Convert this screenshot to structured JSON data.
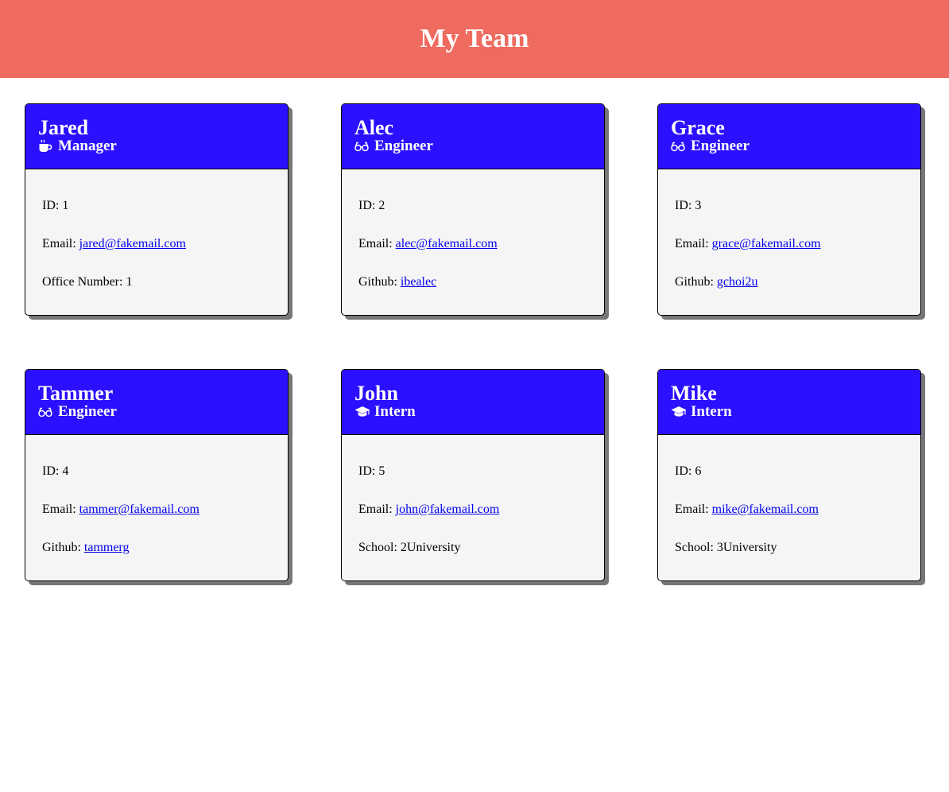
{
  "header": {
    "title": "My Team",
    "background": "#ef6a5f"
  },
  "theme": {
    "card_header_bg": "#2b10ff",
    "card_body_bg": "#f5f5f5",
    "link_color": "#0000ee"
  },
  "cards": [
    {
      "name": "Jared",
      "role": "Manager",
      "icon": "coffee-icon",
      "id_label": "ID: ",
      "id": "1",
      "email_label": "Email: ",
      "email": "jared@fakemail.com",
      "extra_label": "Office Number: ",
      "extra_value": "1"
    },
    {
      "name": "Alec",
      "role": "Engineer",
      "icon": "glasses-icon",
      "id_label": "ID: ",
      "id": "2",
      "email_label": "Email: ",
      "email": "alec@fakemail.com",
      "extra_label": "Github: ",
      "extra_value": "ibealec"
    },
    {
      "name": "Grace",
      "role": "Engineer",
      "icon": "glasses-icon",
      "id_label": "ID: ",
      "id": "3",
      "email_label": "Email: ",
      "email": "grace@fakemail.com",
      "extra_label": "Github: ",
      "extra_value": "gchoi2u"
    },
    {
      "name": "Tammer",
      "role": "Engineer",
      "icon": "glasses-icon",
      "id_label": "ID: ",
      "id": "4",
      "email_label": "Email: ",
      "email": "tammer@fakemail.com",
      "extra_label": "Github: ",
      "extra_value": "tammerg"
    },
    {
      "name": "John",
      "role": "Intern",
      "icon": "graduation-cap-icon",
      "id_label": "ID: ",
      "id": "5",
      "email_label": "Email: ",
      "email": "john@fakemail.com",
      "extra_label": "School: ",
      "extra_value": "2University"
    },
    {
      "name": "Mike",
      "role": "Intern",
      "icon": "graduation-cap-icon",
      "id_label": "ID: ",
      "id": "6",
      "email_label": "Email: ",
      "email": "mike@fakemail.com",
      "extra_label": "School: ",
      "extra_value": "3University"
    }
  ]
}
